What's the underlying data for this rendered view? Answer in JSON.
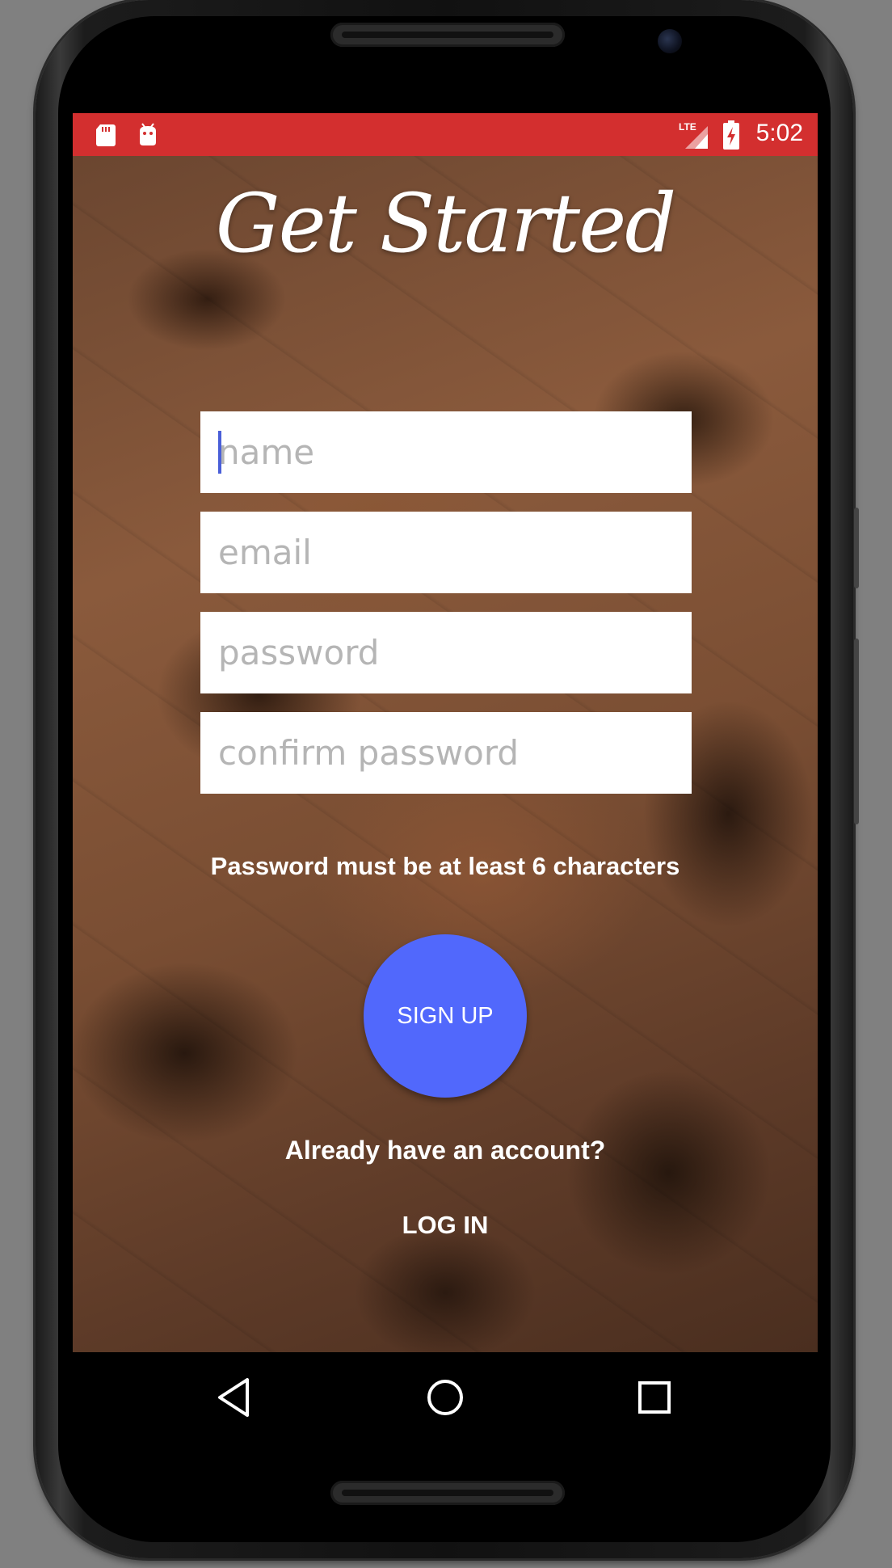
{
  "status_bar": {
    "time": "5:02",
    "network_label": "LTE",
    "left_icons": [
      "sd-card-icon",
      "android-debug-icon"
    ],
    "right_icons": [
      "signal-icon",
      "battery-charging-icon"
    ],
    "color": "#d32f2f"
  },
  "title": "Get Started",
  "form": {
    "name_placeholder": "name",
    "email_placeholder": "email",
    "password_placeholder": "password",
    "confirm_password_placeholder": "confirm password"
  },
  "hint": "Password must be at least 6 characters",
  "signup_label": "SIGN UP",
  "signup_color": "#5168fc",
  "already_text": "Already have an account?",
  "login_label": "LOG IN",
  "nav": {
    "icons": [
      "back-icon",
      "home-icon",
      "recents-icon"
    ]
  }
}
